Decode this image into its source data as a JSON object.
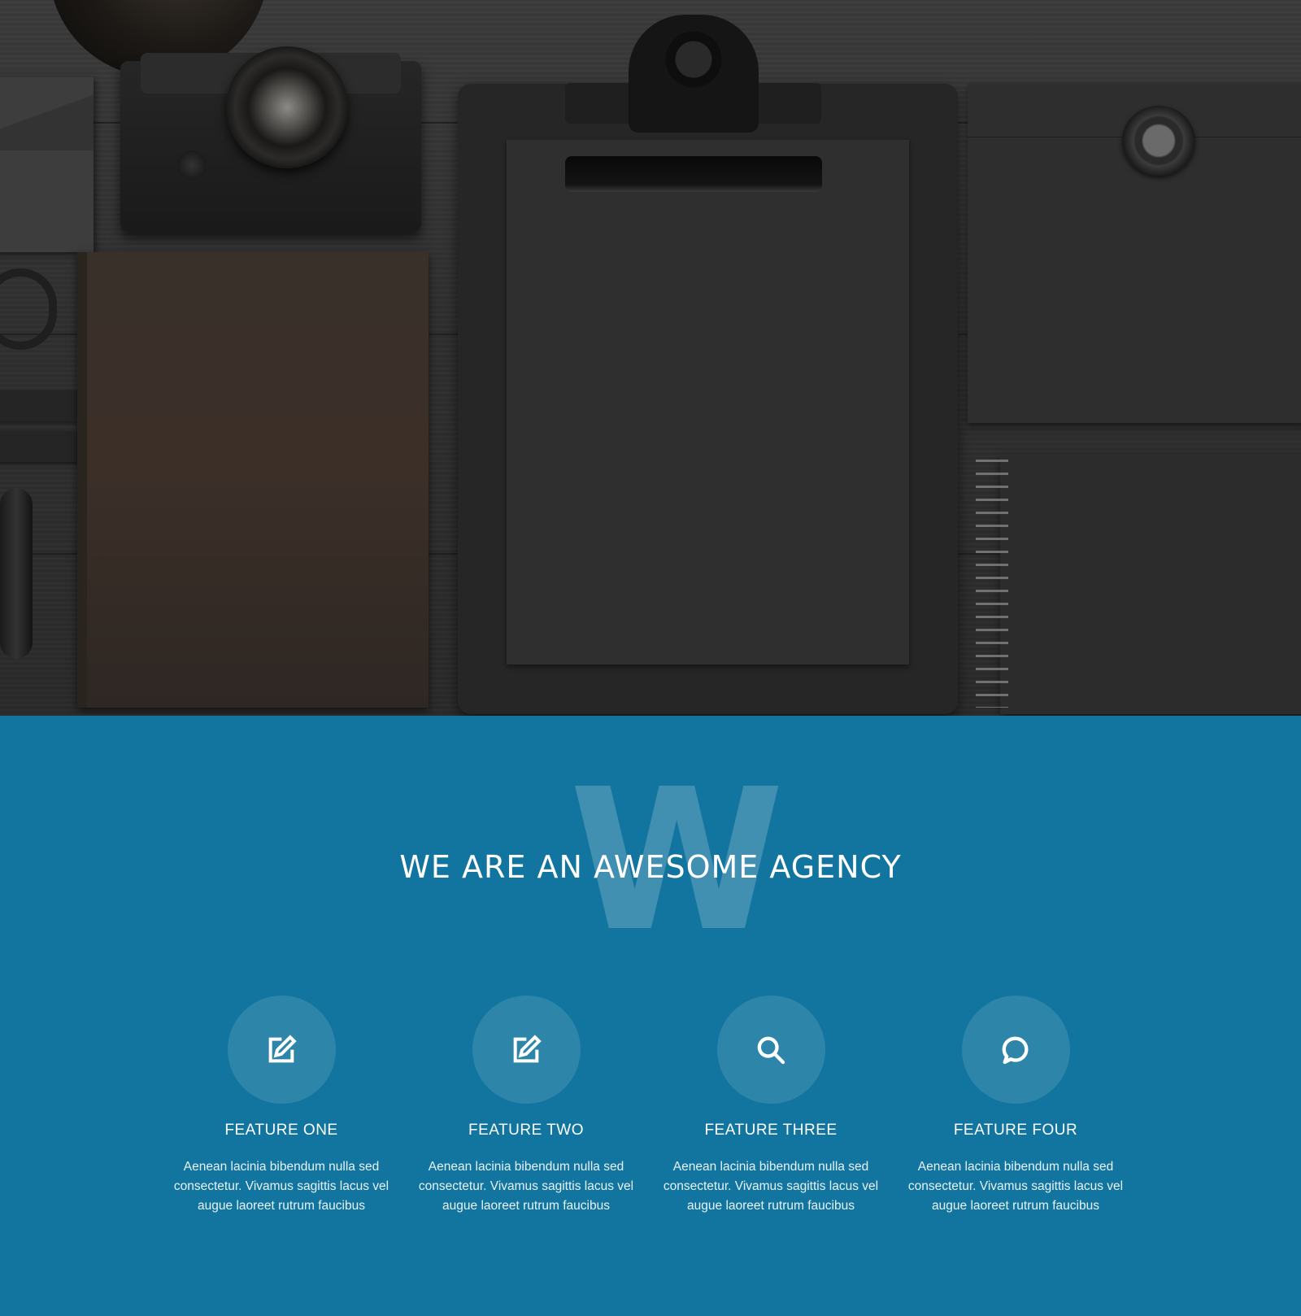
{
  "hero": {
    "image_alt": "Dark desk flat-lay with camera, notebook, clipboard and envelopes"
  },
  "agency": {
    "watermark_letter": "W",
    "headline": "WE ARE AN AWESOME AGENCY",
    "background_color": "#12759f",
    "icon_circle_color": "#2e85aa"
  },
  "features": [
    {
      "icon": "edit-icon",
      "title": "FEATURE ONE",
      "description": "Aenean lacinia bibendum nulla sed consectetur. Vivamus sagittis lacus vel augue laoreet rutrum faucibus"
    },
    {
      "icon": "edit-icon",
      "title": "FEATURE TWO",
      "description": "Aenean lacinia bibendum nulla sed consectetur. Vivamus sagittis lacus vel augue laoreet rutrum faucibus"
    },
    {
      "icon": "search-icon",
      "title": "FEATURE THREE",
      "description": "Aenean lacinia bibendum nulla sed consectetur. Vivamus sagittis lacus vel augue laoreet rutrum faucibus"
    },
    {
      "icon": "chat-bubble-icon",
      "title": "FEATURE FOUR",
      "description": "Aenean lacinia bibendum nulla sed consectetur. Vivamus sagittis lacus vel augue laoreet rutrum faucibus"
    }
  ]
}
